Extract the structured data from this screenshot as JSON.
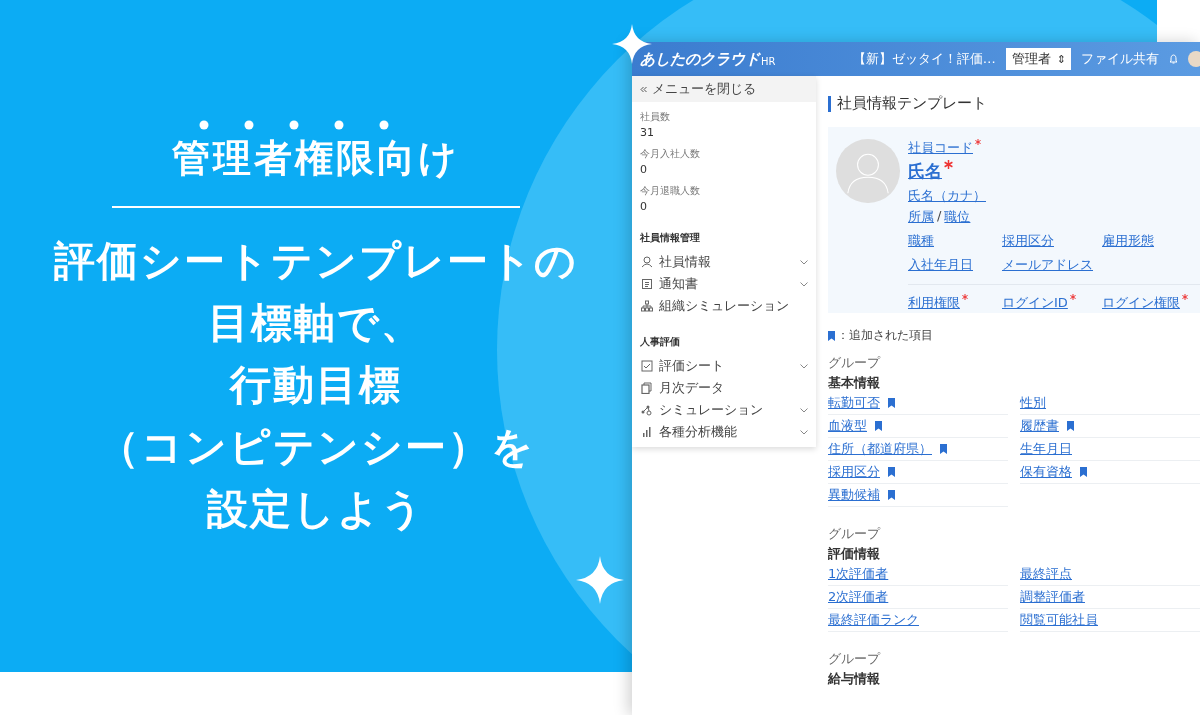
{
  "promo": {
    "heading": "管理者権限向け",
    "lines": [
      "評価シートテンプレートの",
      "目標軸で、",
      "行動目標",
      "（コンピテンシー）を",
      "設定しよう"
    ]
  },
  "app": {
    "logo": "あしたのクラウド",
    "logo_suffix": "HR",
    "header": {
      "notice": "【新】ゼッタイ！評価…",
      "role_select": "管理者",
      "role_select_icon": "⇕",
      "file_share": "ファイル共有"
    },
    "sidebar": {
      "close_menu": "メニューを閉じる",
      "stats": [
        {
          "label": "社員数",
          "value": "31"
        },
        {
          "label": "今月入社人数",
          "value": "0"
        },
        {
          "label": "今月退職人数",
          "value": "0"
        }
      ],
      "sections": [
        {
          "title": "社員情報管理",
          "items": [
            {
              "label": "社員情報",
              "kind": "person",
              "expandable": true
            },
            {
              "label": "通知書",
              "kind": "document",
              "expandable": true
            },
            {
              "label": "組織シミュレーション",
              "kind": "org",
              "expandable": false
            }
          ]
        },
        {
          "title": "人事評価",
          "items": [
            {
              "label": "評価シート",
              "kind": "check",
              "expandable": true
            },
            {
              "label": "月次データ",
              "kind": "copy",
              "expandable": false
            },
            {
              "label": "シミュレーション",
              "kind": "nodes",
              "expandable": true
            },
            {
              "label": "各種分析機能",
              "kind": "bars",
              "expandable": true
            }
          ]
        }
      ]
    },
    "page_title": "社員情報テンプレート",
    "profile": {
      "code": {
        "label": "社員コード",
        "required": true
      },
      "name": {
        "label": "氏名",
        "required": true
      },
      "kana": {
        "label": "氏名（カナ）",
        "required": false
      },
      "dept": "所属",
      "separator": "/",
      "position": "職位",
      "fields": [
        {
          "label": "職種",
          "required": false
        },
        {
          "label": "採用区分",
          "required": false
        },
        {
          "label": "雇用形態",
          "required": false
        },
        {
          "label": "入社年月日",
          "required": false
        },
        {
          "label": "メールアドレス",
          "required": false
        }
      ],
      "account_fields": [
        {
          "label": "利用権限",
          "required": true
        },
        {
          "label": "ログインID",
          "required": true
        },
        {
          "label": "ログイン権限",
          "required": true
        }
      ]
    },
    "legend": "：追加された項目",
    "groups": [
      {
        "caption": "グループ",
        "title": "基本情報",
        "items": [
          {
            "label": "転勤可否",
            "added": true
          },
          {
            "label": "性別",
            "added": false
          },
          {
            "label": "血液型",
            "added": true
          },
          {
            "label": "履歴書",
            "added": true
          },
          {
            "label": "住所（都道府県）",
            "added": true
          },
          {
            "label": "生年月日",
            "added": false
          },
          {
            "label": "採用区分",
            "added": true
          },
          {
            "label": "保有資格",
            "added": true
          },
          {
            "label": "異動候補",
            "added": true
          }
        ]
      },
      {
        "caption": "グループ",
        "title": "評価情報",
        "items": [
          {
            "label": "1次評価者",
            "added": false
          },
          {
            "label": "最終評点",
            "added": false
          },
          {
            "label": "2次評価者",
            "added": false
          },
          {
            "label": "調整評価者",
            "added": false
          },
          {
            "label": "最終評価ランク",
            "added": false
          },
          {
            "label": "閲覧可能社員",
            "added": false
          }
        ]
      },
      {
        "caption": "グループ",
        "title": "給与情報"
      }
    ]
  }
}
